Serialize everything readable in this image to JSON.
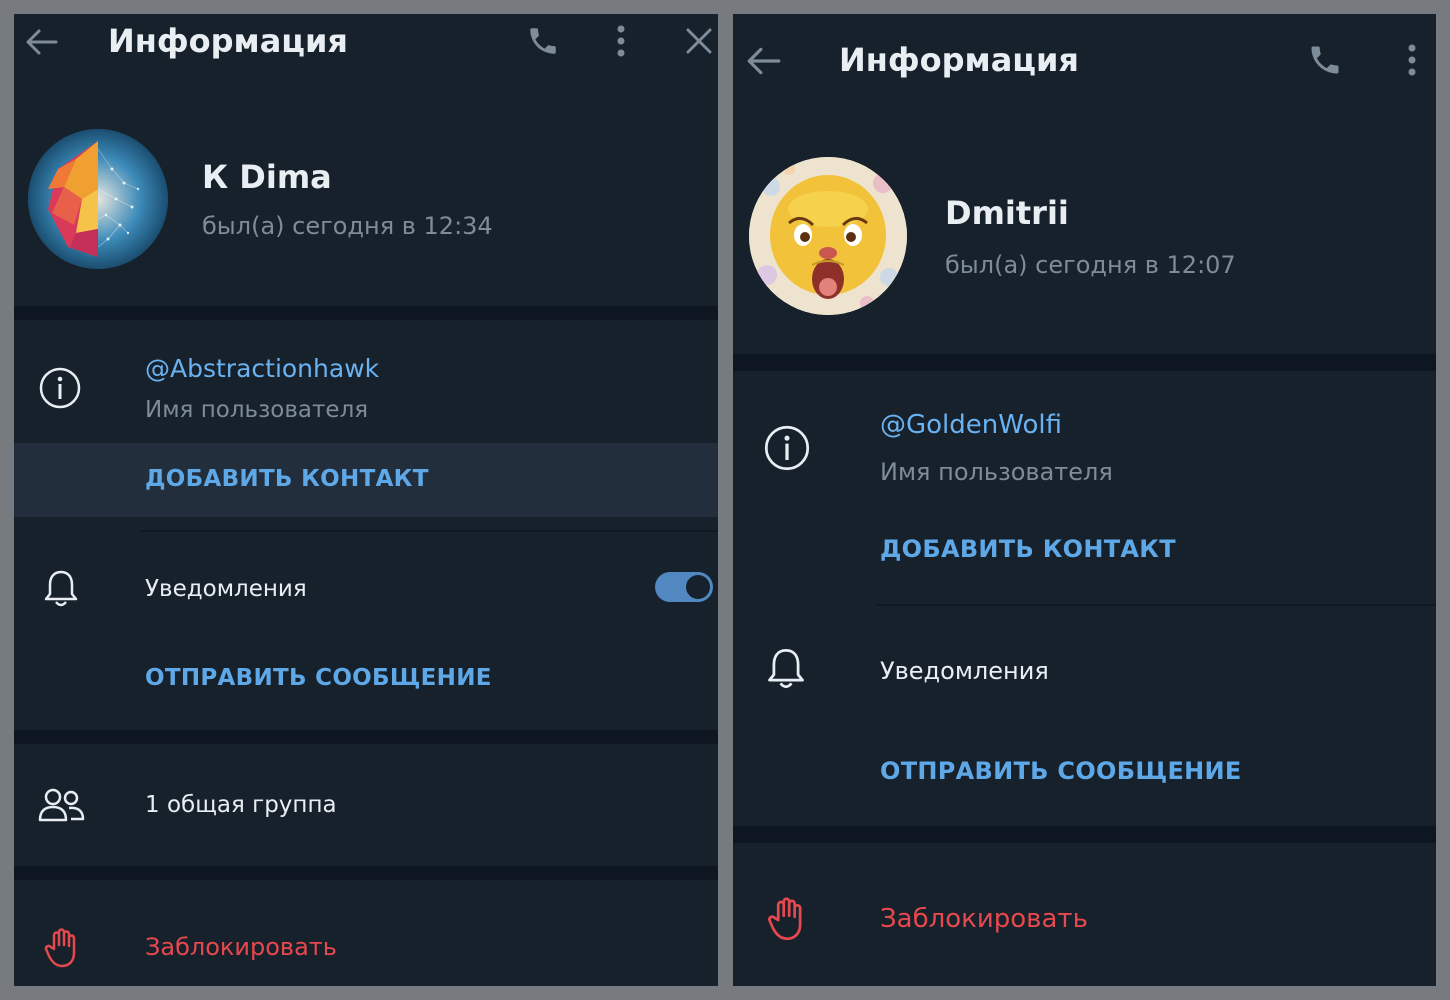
{
  "left": {
    "header": {
      "title": "Информация"
    },
    "profile": {
      "name": "К Dima",
      "status": "был(а) сегодня в 12:34"
    },
    "username": {
      "value": "@Abstractionhawk",
      "caption": "Имя пользователя"
    },
    "add_contact": "ДОБАВИТЬ КОНТАКТ",
    "notifications": {
      "label": "Уведомления",
      "enabled": true
    },
    "send_message": "ОТПРАВИТЬ СООБЩЕНИЕ",
    "groups": "1 общая группа",
    "block": "Заблокировать"
  },
  "right": {
    "header": {
      "title": "Информация"
    },
    "profile": {
      "name": "Dmitrii",
      "status": "был(а) сегодня в 12:07"
    },
    "username": {
      "value": "@GoldenWolfi",
      "caption": "Имя пользователя"
    },
    "add_contact": "ДОБАВИТЬ КОНТАКТ",
    "notifications": {
      "label": "Уведомления"
    },
    "send_message": "ОТПРАВИТЬ СООБЩЕНИЕ",
    "block": "Заблокировать"
  },
  "icons": {
    "back": "arrow-left-icon",
    "call": "phone-icon",
    "menu": "more-vertical-icon",
    "close": "close-icon",
    "info": "info-icon",
    "bell": "bell-icon",
    "users": "users-icon",
    "block": "hand-icon"
  },
  "colors": {
    "panel_bg": "#17212b",
    "separator": "#0e1621",
    "hover": "#232e3c",
    "accent": "#6ab2f2",
    "danger": "#e5484d",
    "text": "#e9eef3",
    "muted": "#7e8b98"
  }
}
